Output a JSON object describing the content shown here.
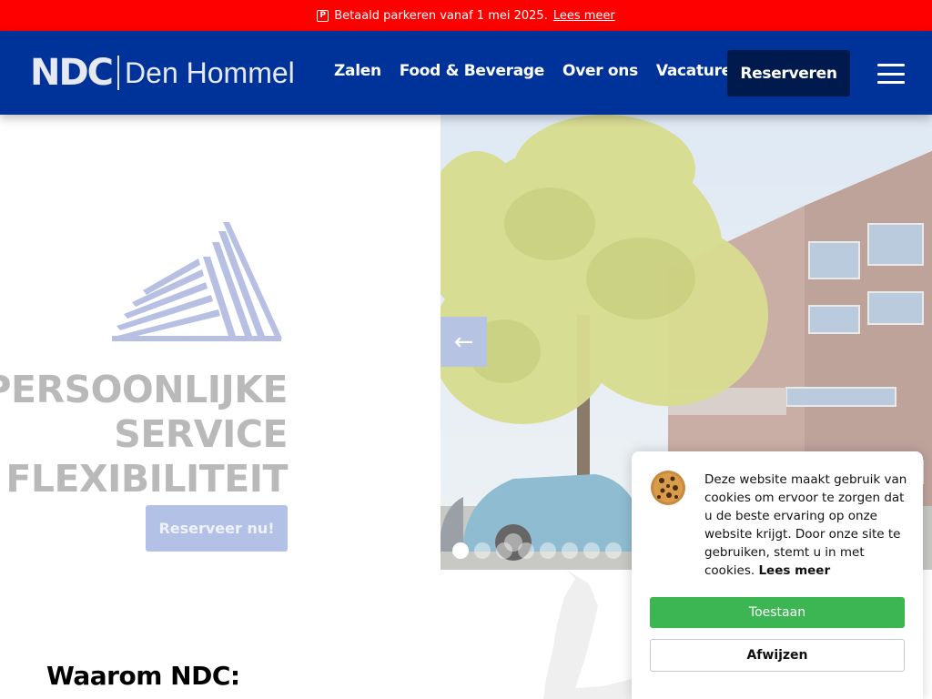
{
  "announcement": {
    "icon": "parking-icon",
    "text": "Betaald parkeren vanaf 1 mei 2025.",
    "link": "Lees meer"
  },
  "header": {
    "logo_ndc": "NDC",
    "logo_name": "Den Hommel",
    "nav": [
      "Zalen",
      "Food & Beverage",
      "Over ons",
      "Vacatures"
    ],
    "reserve_button": "Reserveren",
    "menu_icon": "hamburger-menu-icon"
  },
  "hero": {
    "title_lines": [
      "PERSOONLIJKE",
      "SERVICE",
      "& FLEXIBILITEIT"
    ],
    "cta": "Reserveer nu!",
    "prev_arrow": "←",
    "slide_count": 8,
    "active_slide": 1
  },
  "section": {
    "why_title": "Waarom NDC:"
  },
  "cookie": {
    "text": "Deze website maakt gebruik van cookies om ervoor te zorgen dat u de beste ervaring op onze website krijgt. Door onze site te gebruiken, stemt u in met cookies.",
    "link": "Lees meer",
    "accept": "Toestaan",
    "reject": "Afwijzen"
  },
  "colors": {
    "topbar": "#ff0000",
    "header": "#003399",
    "reserve": "#001a4d",
    "accept": "#3cb653"
  }
}
